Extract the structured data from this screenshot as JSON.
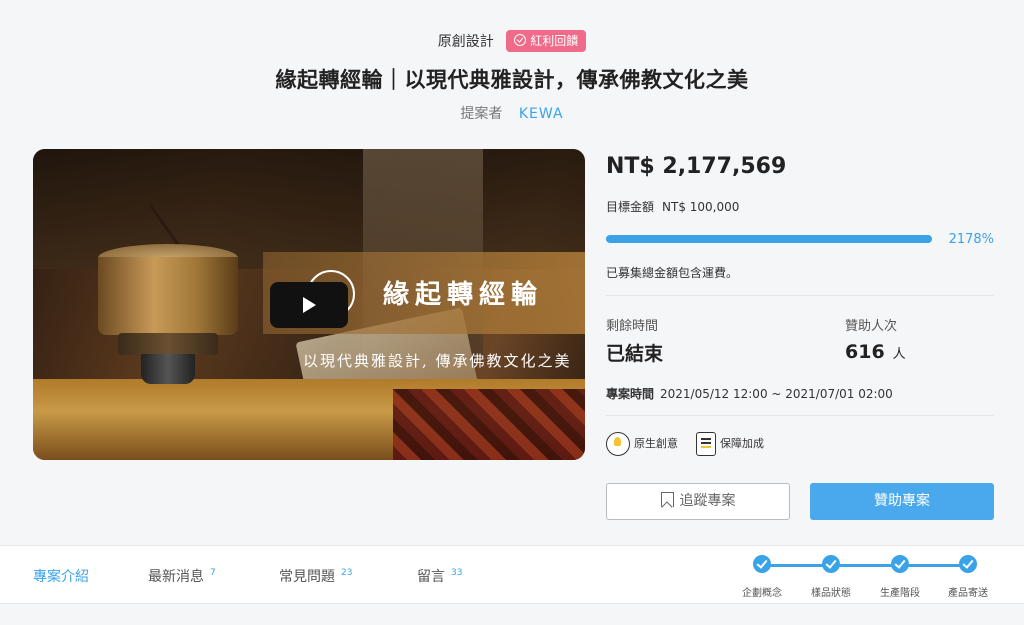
{
  "header": {
    "category": "原創設計",
    "badge": "紅利回饋",
    "title": "緣起轉經輪｜以現代典雅設計，傳承佛教文化之美",
    "proposer_label": "提案者",
    "proposer_name": "KEWA"
  },
  "hero": {
    "banner_title": "緣起轉經輪",
    "banner_subtitle": "以現代典雅設計, 傳承佛教文化之美"
  },
  "funding": {
    "raised": "NT$ 2,177,569",
    "goal_label": "目標金額",
    "goal_value": "NT$ 100,000",
    "percent_text": "2178%",
    "progress": 1.0,
    "note": "已募集總金額包含運費。",
    "remaining_label": "剩餘時間",
    "remaining_value": "已結束",
    "backers_label": "贊助人次",
    "backers_value": "616",
    "backers_unit": "人",
    "period_label": "專案時間",
    "period_value": "2021/05/12 12:00 ~ 2021/07/01 02:00",
    "features": [
      "原生創意",
      "保障加成"
    ],
    "follow_button": "追蹤專案",
    "back_button": "贊助專案",
    "accent_color": "#3aa3e8"
  },
  "tabs": [
    {
      "label": "專案介紹",
      "count": ""
    },
    {
      "label": "最新消息",
      "count": "7"
    },
    {
      "label": "常見問題",
      "count": "23"
    },
    {
      "label": "留言",
      "count": "33"
    }
  ],
  "steps": [
    "企劃概念",
    "樣品狀態",
    "生產階段",
    "產品寄送"
  ]
}
